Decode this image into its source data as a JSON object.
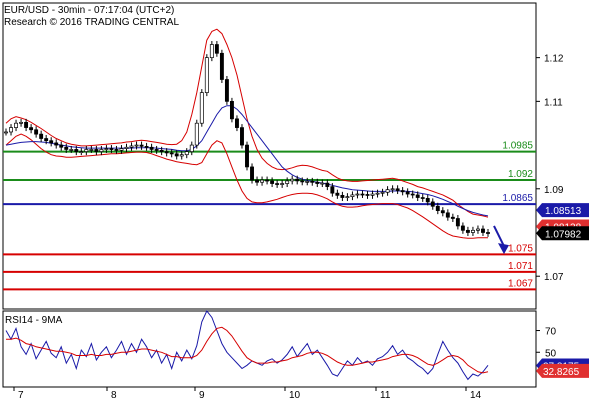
{
  "chart_data": [
    {
      "type": "candlestick",
      "header": {
        "line1": "EUR/USD - 30min - 07:17:04 (UTC+2)",
        "line2": "Research © 2016 TRADING CENTRAL"
      },
      "x_labels": [
        "7",
        "8",
        "9",
        "10",
        "11",
        "14"
      ],
      "ylim": [
        1.0625,
        1.1325
      ],
      "y_ticks": [
        {
          "value": 1.12,
          "label": "1.12"
        },
        {
          "value": 1.11,
          "label": "1.11"
        },
        {
          "value": 1.09,
          "label": "1.09"
        },
        {
          "value": 1.07,
          "label": "1.07"
        }
      ],
      "price_close": [
        1.103,
        1.104,
        1.105,
        1.1052,
        1.104,
        1.1035,
        1.1025,
        1.1015,
        1.101,
        1.1005,
        1.1,
        1.0995,
        1.099,
        1.099,
        1.0985,
        1.0985,
        1.099,
        1.099,
        1.0985,
        1.099,
        1.0992,
        1.099,
        1.0988,
        1.0992,
        1.0995,
        1.0998,
        1.1,
        1.0997,
        1.0995,
        1.099,
        1.0988,
        1.0985,
        1.0982,
        1.098,
        1.0975,
        1.0978,
        1.0985,
        1.1,
        1.105,
        1.112,
        1.12,
        1.123,
        1.121,
        1.115,
        1.11,
        1.106,
        1.104,
        1.1,
        1.095,
        1.092,
        1.0915,
        1.092,
        1.0918,
        1.0912,
        1.091,
        1.0912,
        1.0918,
        1.0922,
        1.0918,
        1.0916,
        1.0917,
        1.0915,
        1.0912,
        1.0913,
        1.0905,
        1.089,
        1.0885,
        1.088,
        1.0882,
        1.0886,
        1.0888,
        1.0887,
        1.0885,
        1.0888,
        1.089,
        1.0892,
        1.0898,
        1.09,
        1.0896,
        1.0893,
        1.0888,
        1.0886,
        1.088,
        1.0878,
        1.087,
        1.086,
        1.085,
        1.0845,
        1.0835,
        1.0832,
        1.0815,
        1.0805,
        1.08,
        1.0805,
        1.0808,
        1.08,
        1.0798
      ],
      "bollinger_upper": [
        1.105,
        1.106,
        1.1065,
        1.1062,
        1.1058,
        1.1052,
        1.1045,
        1.1038,
        1.103,
        1.1022,
        1.1015,
        1.101,
        1.1005,
        1.1002,
        1.1,
        1.0998,
        1.0998,
        1.0999,
        1.1,
        1.1001,
        1.1002,
        1.1003,
        1.1004,
        1.1005,
        1.1007,
        1.1008,
        1.101,
        1.1011,
        1.101,
        1.1008,
        1.1006,
        1.1004,
        1.1002,
        1.1001,
        1.1002,
        1.101,
        1.103,
        1.107,
        1.112,
        1.118,
        1.124,
        1.126,
        1.1265,
        1.1255,
        1.123,
        1.12,
        1.116,
        1.111,
        1.106,
        1.102,
        1.099,
        1.097,
        1.0958,
        1.095,
        1.0945,
        1.0944,
        1.0945,
        1.0948,
        1.0952,
        1.0954,
        1.0953,
        1.095,
        1.0946,
        1.0942,
        1.094,
        1.0932,
        1.0925,
        1.092,
        1.0918,
        1.0917,
        1.0917,
        1.0918,
        1.0919,
        1.092,
        1.0921,
        1.0922,
        1.0923,
        1.0924,
        1.0922,
        1.0918,
        1.0914,
        1.091,
        1.0905,
        1.0902,
        1.0898,
        1.0894,
        1.089,
        1.0886,
        1.088,
        1.0874,
        1.0864,
        1.0856,
        1.0848,
        1.0842,
        1.084,
        1.0838,
        1.0835
      ],
      "bollinger_lower": [
        1.1,
        1.101,
        1.102,
        1.1025,
        1.102,
        1.1012,
        1.1002,
        1.0992,
        1.0984,
        1.0978,
        1.0975,
        1.0974,
        1.0972,
        1.0972,
        1.0973,
        1.0974,
        1.0975,
        1.0976,
        1.0977,
        1.0978,
        1.0979,
        1.098,
        1.098,
        1.0981,
        1.0982,
        1.0983,
        1.0984,
        1.0984,
        1.0983,
        1.098,
        1.0976,
        1.0972,
        1.0968,
        1.0965,
        1.0962,
        1.096,
        1.0958,
        1.0956,
        1.0955,
        1.096,
        1.098,
        1.1,
        1.101,
        1.1005,
        1.098,
        1.095,
        1.092,
        1.0895,
        1.0878,
        1.087,
        1.0868,
        1.0868,
        1.087,
        1.0873,
        1.0876,
        1.088,
        1.0884,
        1.0887,
        1.0889,
        1.089,
        1.089,
        1.0889,
        1.0886,
        1.0882,
        1.0877,
        1.087,
        1.0864,
        1.086,
        1.0858,
        1.0858,
        1.0859,
        1.0861,
        1.0863,
        1.0864,
        1.0865,
        1.0866,
        1.0866,
        1.0866,
        1.0864,
        1.086,
        1.0856,
        1.085,
        1.0843,
        1.0836,
        1.0828,
        1.082,
        1.0812,
        1.0804,
        1.0797,
        1.0792,
        1.079,
        1.0788,
        1.0787,
        1.0787,
        1.0788,
        1.0788,
        1.0788
      ],
      "moving_average": [
        1.1,
        1.1002,
        1.1004,
        1.1006,
        1.1007,
        1.1008,
        1.1008,
        1.1007,
        1.1006,
        1.1004,
        1.1002,
        1.1,
        1.0998,
        1.0996,
        1.0995,
        1.0994,
        1.0993,
        1.0993,
        1.0993,
        1.0993,
        1.0993,
        1.0993,
        1.0993,
        1.0993,
        1.0993,
        1.0993,
        1.0994,
        1.0994,
        1.0994,
        1.0994,
        1.0993,
        1.0992,
        1.0991,
        1.099,
        1.0988,
        1.0987,
        1.0987,
        1.099,
        1.0998,
        1.101,
        1.103,
        1.105,
        1.107,
        1.1085,
        1.109,
        1.109,
        1.1082,
        1.107,
        1.1055,
        1.104,
        1.1025,
        1.101,
        1.0995,
        1.098,
        1.0965,
        1.095,
        1.094,
        1.0932,
        1.0926,
        1.0922,
        1.0919,
        1.0917,
        1.0915,
        1.0913,
        1.0911,
        1.0908,
        1.0905,
        1.0902,
        1.09,
        1.0898,
        1.0897,
        1.0896,
        1.0895,
        1.0894,
        1.0894,
        1.0894,
        1.0894,
        1.0895,
        1.0895,
        1.0895,
        1.0894,
        1.0893,
        1.0891,
        1.0889,
        1.0887,
        1.0884,
        1.088,
        1.0876,
        1.0871,
        1.0866,
        1.086,
        1.0855,
        1.085,
        1.0846,
        1.0843,
        1.084,
        1.0838
      ],
      "levels": [
        {
          "value": 1.0985,
          "label": "1.0985",
          "color": "#1a8c1a"
        },
        {
          "value": 1.092,
          "label": "1.092",
          "color": "#1a8c1a"
        },
        {
          "value": 1.0865,
          "label": "1.0865",
          "color": "#1a1aa8"
        },
        {
          "value": 1.075,
          "label": "1.075",
          "color": "#d60000"
        },
        {
          "value": 1.071,
          "label": "1.071",
          "color": "#d60000"
        },
        {
          "value": 1.067,
          "label": "1.067",
          "color": "#d60000"
        }
      ],
      "price_tags": [
        {
          "value": 1.08513,
          "label": "1.08513",
          "bg": "#1a1aa8",
          "fg": "#ffffff"
        },
        {
          "value": 1.08138,
          "label": "1.08138",
          "bg": "#e03030",
          "fg": "#ffffff"
        },
        {
          "value": 1.07982,
          "label": "1.07982",
          "bg": "#000000",
          "fg": "#ffffff"
        }
      ],
      "forecast_arrow": {
        "from": 1.0815,
        "to": 1.0755,
        "color": "#1a1aa8"
      }
    },
    {
      "type": "line",
      "title": "RSI14 - 9MA",
      "ylim": [
        18,
        88
      ],
      "y_ticks": [
        {
          "value": 70,
          "label": "70"
        },
        {
          "value": 50,
          "label": "50"
        }
      ],
      "series": [
        {
          "color": "#1a1aa8",
          "values": [
            70,
            62,
            72,
            55,
            48,
            58,
            44,
            52,
            60,
            49,
            45,
            55,
            40,
            48,
            35,
            52,
            46,
            58,
            43,
            50,
            55,
            45,
            52,
            60,
            48,
            58,
            50,
            62,
            55,
            45,
            52,
            40,
            48,
            35,
            50,
            42,
            52,
            44,
            56,
            78,
            88,
            82,
            70,
            58,
            50,
            45,
            40,
            35,
            38,
            42,
            40,
            38,
            42,
            44,
            40,
            43,
            48,
            55,
            46,
            52,
            58,
            48,
            52,
            45,
            38,
            30,
            28,
            35,
            42,
            38,
            45,
            40,
            42,
            38,
            44,
            46,
            50,
            56,
            48,
            52,
            45,
            42,
            38,
            35,
            30,
            35,
            48,
            60,
            52,
            45,
            40,
            32,
            25,
            30,
            28,
            32,
            38
          ]
        },
        {
          "color": "#d60000",
          "values": [
            62,
            62,
            63,
            61,
            58,
            57,
            55,
            54,
            53,
            52,
            51,
            51,
            50,
            49,
            47,
            47,
            47,
            48,
            47,
            47,
            48,
            48,
            49,
            50,
            50,
            51,
            52,
            53,
            53,
            52,
            51,
            50,
            48,
            46,
            46,
            45,
            45,
            45,
            47,
            52,
            60,
            67,
            72,
            73,
            70,
            65,
            58,
            51,
            45,
            42,
            40,
            40,
            40,
            41,
            41,
            42,
            43,
            45,
            46,
            47,
            49,
            50,
            50,
            49,
            47,
            44,
            41,
            39,
            38,
            38,
            39,
            40,
            41,
            41,
            42,
            43,
            44,
            46,
            47,
            48,
            48,
            47,
            45,
            42,
            39,
            38,
            40,
            43,
            46,
            47,
            46,
            43,
            38,
            35,
            32,
            31,
            32
          ]
        }
      ],
      "value_tags": [
        {
          "value": 37.8175,
          "label": "37.8175",
          "bg": "#1a1aa8",
          "fg": "#ffffff"
        },
        {
          "value": 32.8265,
          "label": "32.8265",
          "bg": "#e03030",
          "fg": "#ffffff"
        }
      ]
    }
  ]
}
